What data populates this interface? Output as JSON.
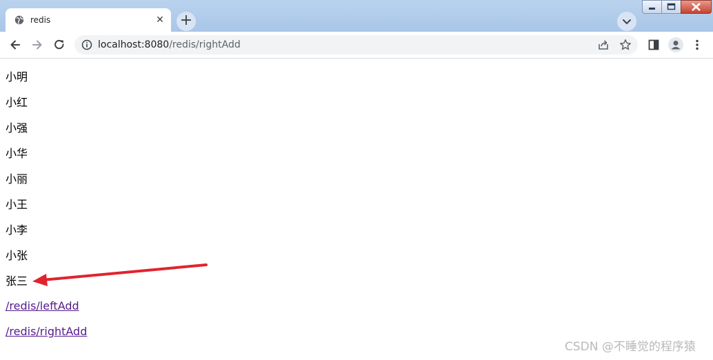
{
  "browser": {
    "tab": {
      "title": "redis",
      "favicon": "globe-icon",
      "close_icon": "close-icon"
    },
    "new_tab_icon": "plus-icon",
    "tab_search_icon": "chevron-down-icon",
    "window_controls": [
      "minimize-icon",
      "restore-icon",
      "close-icon"
    ]
  },
  "toolbar": {
    "back_icon": "arrow-left-icon",
    "forward_icon": "arrow-right-icon",
    "reload_icon": "reload-icon",
    "address": {
      "host": "localhost:8080",
      "path": "/redis/rightAdd",
      "info_icon": "info-icon"
    },
    "share_icon": "share-icon",
    "bookmark_icon": "star-icon",
    "sidepanel_icon": "side-panel-icon",
    "profile_icon": "person-icon",
    "menu_icon": "kebab-menu-icon"
  },
  "page": {
    "items": [
      "小明",
      "小红",
      "小强",
      "小华",
      "小丽",
      "小王",
      "小李",
      "小张",
      "张三"
    ],
    "links": [
      "/redis/leftAdd",
      "/redis/rightAdd"
    ],
    "link_color": "#551a8b"
  },
  "annotation": {
    "arrow_color": "#e0232e"
  },
  "watermark": "CSDN @不睡觉的程序猿"
}
